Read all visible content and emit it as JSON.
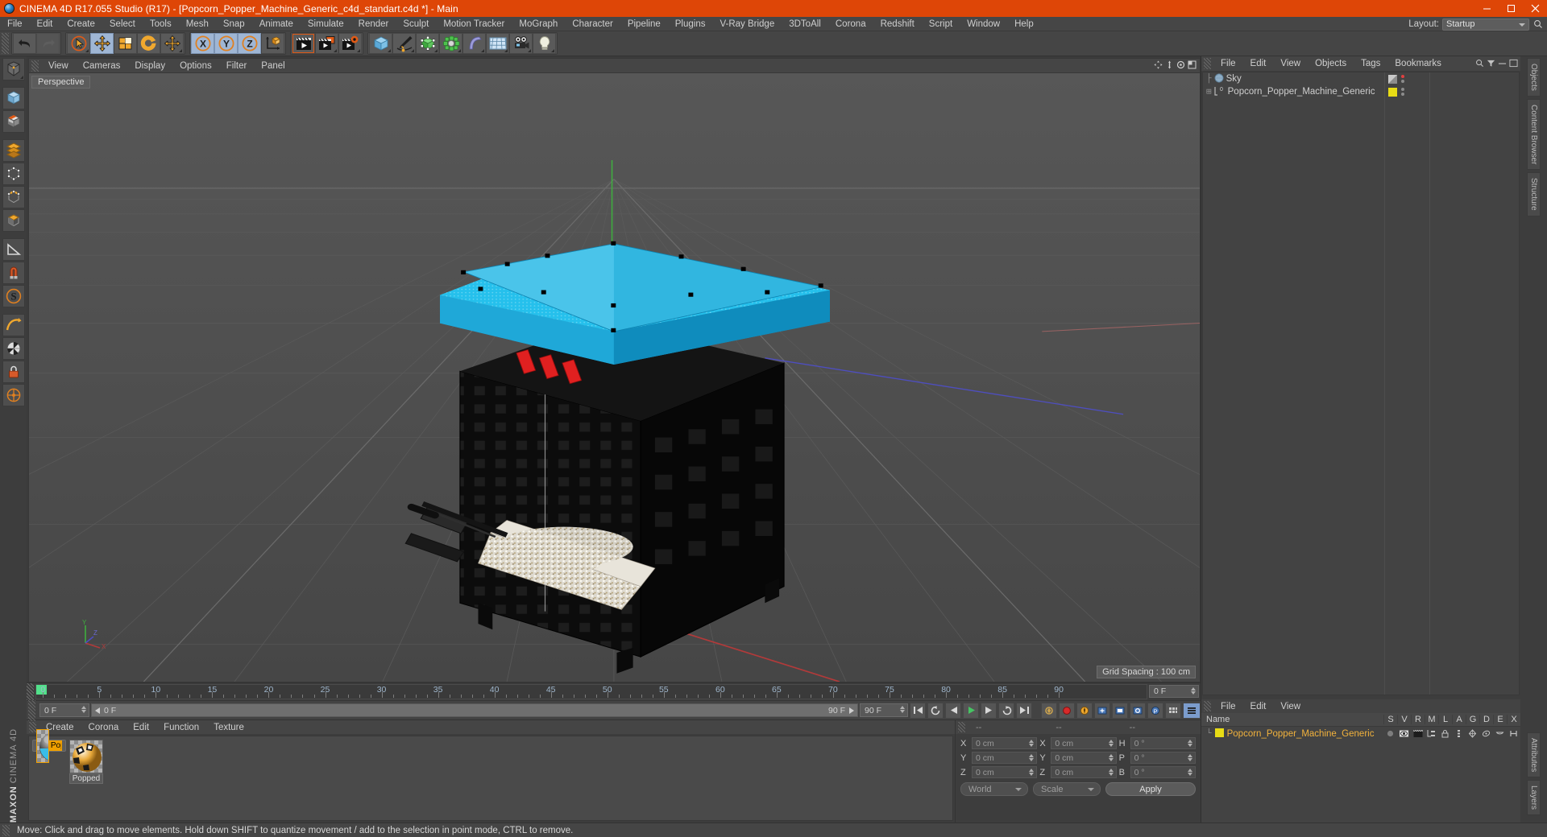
{
  "window": {
    "title": "CINEMA 4D R17.055 Studio (R17) - [Popcorn_Popper_Machine_Generic_c4d_standart.c4d *] - Main",
    "minimize": "minimize-button",
    "maximize": "maximize-button",
    "close": "close-button",
    "accent": "#de4607"
  },
  "menubar": {
    "items": [
      "File",
      "Edit",
      "Create",
      "Select",
      "Tools",
      "Mesh",
      "Snap",
      "Animate",
      "Simulate",
      "Render",
      "Sculpt",
      "Motion Tracker",
      "MoGraph",
      "Character",
      "Pipeline",
      "Plugins",
      "V-Ray Bridge",
      "3DToAll",
      "Corona",
      "Redshift",
      "Script",
      "Window",
      "Help"
    ],
    "layout_label": "Layout:",
    "layout_value": "Startup"
  },
  "toolbar": {
    "groups": [
      {
        "buttons": [
          {
            "name": "undo-button",
            "icon": "undo-arrow",
            "state": "normal"
          },
          {
            "name": "redo-button",
            "icon": "redo-arrow",
            "state": "disabled"
          }
        ]
      },
      {
        "buttons": [
          {
            "name": "live-selection-tool",
            "icon": "cursor-circle",
            "state": "normal"
          },
          {
            "name": "move-tool",
            "icon": "move-cross",
            "state": "active"
          },
          {
            "name": "scale-tool",
            "icon": "scale-box",
            "state": "normal"
          },
          {
            "name": "rotate-tool",
            "icon": "rotate-arrows",
            "state": "normal"
          },
          {
            "name": "move-dup-tool",
            "icon": "move-cross",
            "state": "normal"
          }
        ]
      },
      {
        "buttons": [
          {
            "name": "axis-x-toggle",
            "icon": "letter-x",
            "state": "active"
          },
          {
            "name": "axis-y-toggle",
            "icon": "letter-y",
            "state": "active"
          },
          {
            "name": "axis-z-toggle",
            "icon": "letter-z",
            "state": "active"
          },
          {
            "name": "world-object-axis-toggle",
            "icon": "axis-cube",
            "state": "normal"
          }
        ]
      },
      {
        "buttons": [
          {
            "name": "render-view-button",
            "icon": "clapboard",
            "state": "framed"
          },
          {
            "name": "render-to-picture-viewer-button",
            "icon": "clapboard-window",
            "state": "normal"
          },
          {
            "name": "render-settings-button",
            "icon": "clapboard-gear",
            "state": "normal"
          }
        ]
      },
      {
        "buttons": [
          {
            "name": "add-cube-button",
            "icon": "blue-cube",
            "state": "normal"
          },
          {
            "name": "add-spline-button",
            "icon": "pen-spline",
            "state": "normal"
          },
          {
            "name": "add-nurbs-button",
            "icon": "green-nurbs",
            "state": "normal"
          },
          {
            "name": "add-array-button",
            "icon": "green-array",
            "state": "normal"
          },
          {
            "name": "add-deformer-button",
            "icon": "purple-bend",
            "state": "normal"
          },
          {
            "name": "add-scene-object-button",
            "icon": "floor-grid",
            "state": "normal"
          },
          {
            "name": "add-camera-button",
            "icon": "camera",
            "state": "normal"
          },
          {
            "name": "add-light-button",
            "icon": "light-bulb",
            "state": "normal"
          }
        ]
      }
    ]
  },
  "left_toolbar": {
    "items": [
      {
        "name": "make-editable-button",
        "icon": "editable-mesh"
      },
      {
        "name": "model-mode-button",
        "icon": "model-cube"
      },
      {
        "name": "texture-mode-button",
        "icon": "texture-checker"
      },
      {
        "name": "polygon-mode-button",
        "icon": "polygon-layers"
      },
      {
        "name": "points-mode-button",
        "icon": "points-cube"
      },
      {
        "name": "edges-mode-button",
        "icon": "edges-cube"
      },
      {
        "name": "faces-mode-button",
        "icon": "faces-cube"
      },
      {
        "name": "workplane-button",
        "icon": "workplane"
      },
      {
        "name": "lock-workplane-button",
        "icon": "magnet-lock"
      },
      {
        "name": "snap-button",
        "icon": "snap-S"
      },
      {
        "name": "quantize-button",
        "icon": "quantize-arc"
      },
      {
        "name": "viewport-solo-button",
        "icon": "checker-sphere"
      },
      {
        "name": "lock-button",
        "icon": "lock-closed"
      },
      {
        "name": "enable-axis-button",
        "icon": "axis-circle"
      }
    ],
    "maxon_line1": "MAXON",
    "maxon_line2": "CINEMA 4D"
  },
  "viewport": {
    "menu": [
      "View",
      "Cameras",
      "Display",
      "Options",
      "Filter",
      "Panel"
    ],
    "perspective_label": "Perspective",
    "grid_spacing": "Grid Spacing : 100 cm",
    "axis_labels": {
      "x": "X",
      "y": "Y",
      "z": "Z"
    },
    "icons": [
      "move-view-icon",
      "scale-view-icon",
      "rotate-view-icon",
      "maximize-view-icon"
    ]
  },
  "timeline": {
    "ticks": [
      0,
      5,
      10,
      15,
      20,
      25,
      30,
      35,
      40,
      45,
      50,
      55,
      60,
      65,
      70,
      75,
      80,
      85,
      90
    ],
    "current_frame_marker": 0,
    "end_field": "0 F"
  },
  "transport": {
    "current_frame": "0 F",
    "scrub_start": "0 F",
    "scrub_end": "90 F",
    "preview_end": "90 F",
    "buttons": [
      {
        "name": "go-to-start-button",
        "icon": "skip-back"
      },
      {
        "name": "play-backwards-button",
        "icon": "rewind-loop"
      },
      {
        "name": "previous-frame-button",
        "icon": "step-back"
      },
      {
        "name": "play-button",
        "icon": "play"
      },
      {
        "name": "next-frame-button",
        "icon": "step-forward"
      },
      {
        "name": "play-forwards-loop-button",
        "icon": "forward-loop"
      },
      {
        "name": "go-to-end-button",
        "icon": "skip-forward"
      },
      {
        "name": "record-active-objects-button",
        "icon": "record-key"
      },
      {
        "name": "autokeying-button",
        "icon": "red-record"
      },
      {
        "name": "keyframe-selection-button",
        "icon": "orange-key"
      },
      {
        "name": "position-key-button",
        "icon": "key-position"
      },
      {
        "name": "scale-key-button",
        "icon": "key-scale"
      },
      {
        "name": "rotation-key-button",
        "icon": "key-rotation"
      },
      {
        "name": "param-key-button",
        "icon": "key-param"
      },
      {
        "name": "pla-key-button",
        "icon": "key-pla"
      },
      {
        "name": "level-of-detail-button",
        "icon": "dots-grid"
      },
      {
        "name": "timeline-mode-button",
        "icon": "bars"
      }
    ]
  },
  "materials": {
    "menu": [
      "Create",
      "Corona",
      "Edit",
      "Function",
      "Texture"
    ],
    "items": [
      {
        "name": "Popcorn",
        "label": "Popcorr",
        "selected": true
      },
      {
        "name": "Popped",
        "label": "Popped",
        "selected": false
      }
    ]
  },
  "coordinates": {
    "headers": [
      "--",
      "--",
      "--"
    ],
    "rows": [
      {
        "label1": "X",
        "value1": "0 cm",
        "label2": "X",
        "value2": "0 cm",
        "label3": "H",
        "value3": "0 °"
      },
      {
        "label1": "Y",
        "value1": "0 cm",
        "label2": "Y",
        "value2": "0 cm",
        "label3": "P",
        "value3": "0 °"
      },
      {
        "label1": "Z",
        "value1": "0 cm",
        "label2": "Z",
        "value2": "0 cm",
        "label3": "B",
        "value3": "0 °"
      }
    ],
    "system": "World",
    "mode": "Scale",
    "apply": "Apply"
  },
  "object_manager": {
    "menu": [
      "File",
      "Edit",
      "View",
      "Objects",
      "Tags",
      "Bookmarks"
    ],
    "rows": [
      {
        "name": "Sky",
        "icon": "sky-sphere",
        "tag_color": "#9a9a9a",
        "highlight": false
      },
      {
        "name": "Popcorn_Popper_Machine_Generic",
        "icon": "null-object",
        "tag_color": "#e8dc15",
        "highlight": false
      }
    ]
  },
  "attribute_manager": {
    "menu": [
      "File",
      "Edit",
      "View"
    ],
    "columns": [
      "Name",
      "S",
      "V",
      "R",
      "M",
      "L",
      "A",
      "G",
      "D",
      "E",
      "X"
    ],
    "rows": [
      {
        "name": "Popcorn_Popper_Machine_Generic",
        "color": "#e8dc15"
      }
    ]
  },
  "right_tabs": [
    "Objects",
    "Content Browser",
    "Structure",
    "Attributes",
    "Layers"
  ],
  "statusbar": {
    "text": "Move: Click and drag to move elements. Hold down SHIFT to quantize movement / add to the selection in point mode, CTRL to remove."
  }
}
